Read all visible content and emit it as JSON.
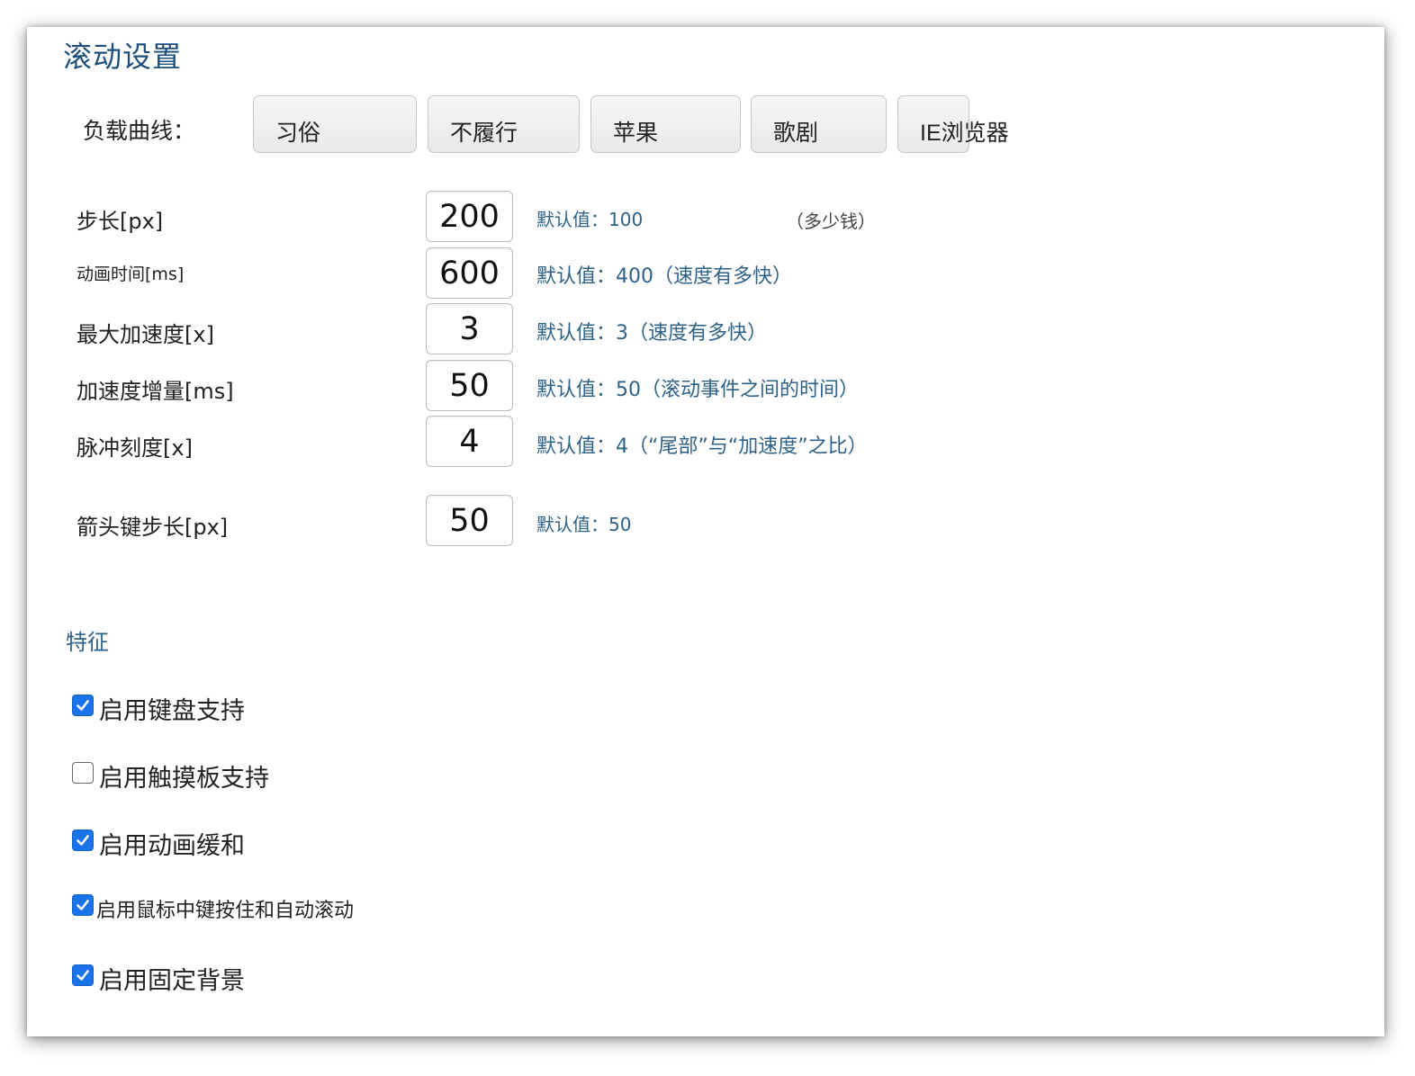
{
  "title": "滚动设置",
  "curve": {
    "label": "负载曲线：",
    "presets": [
      {
        "label": "习俗"
      },
      {
        "label": "不履行"
      },
      {
        "label": "苹果"
      },
      {
        "label": "歌剧"
      },
      {
        "label": "IE浏览器"
      }
    ]
  },
  "rows": [
    {
      "label": "步长[px]",
      "value": "200",
      "hint": "默认值：100",
      "extra": "（多少钱）"
    },
    {
      "label": "动画时间[ms]",
      "value": "600",
      "hint": "默认值：400（速度有多快）"
    },
    {
      "label": "最大加速度[x]",
      "value": "3",
      "hint": "默认值：3（速度有多快）"
    },
    {
      "label": "加速度增量[ms]",
      "value": "50",
      "hint": "默认值：50（滚动事件之间的时间）"
    },
    {
      "label": "脉冲刻度[x]",
      "value": "4",
      "hint": "默认值：4（“尾部”与“加速度”之比）"
    },
    {
      "label": "箭头键步长[px]",
      "value": "50",
      "hint": "默认值：50"
    }
  ],
  "features": {
    "title": "特征",
    "items": [
      {
        "label": "启用键盘支持",
        "checked": true
      },
      {
        "label": "启用触摸板支持",
        "checked": false
      },
      {
        "label": "启用动画缓和",
        "checked": true
      },
      {
        "label": "启用鼠标中键按住和自动滚动",
        "checked": true
      },
      {
        "label": "启用固定背景",
        "checked": true
      }
    ]
  },
  "colors": {
    "title": "#1d4f7a",
    "hint": "#2e6287",
    "checkbox": "#1a73e8"
  }
}
